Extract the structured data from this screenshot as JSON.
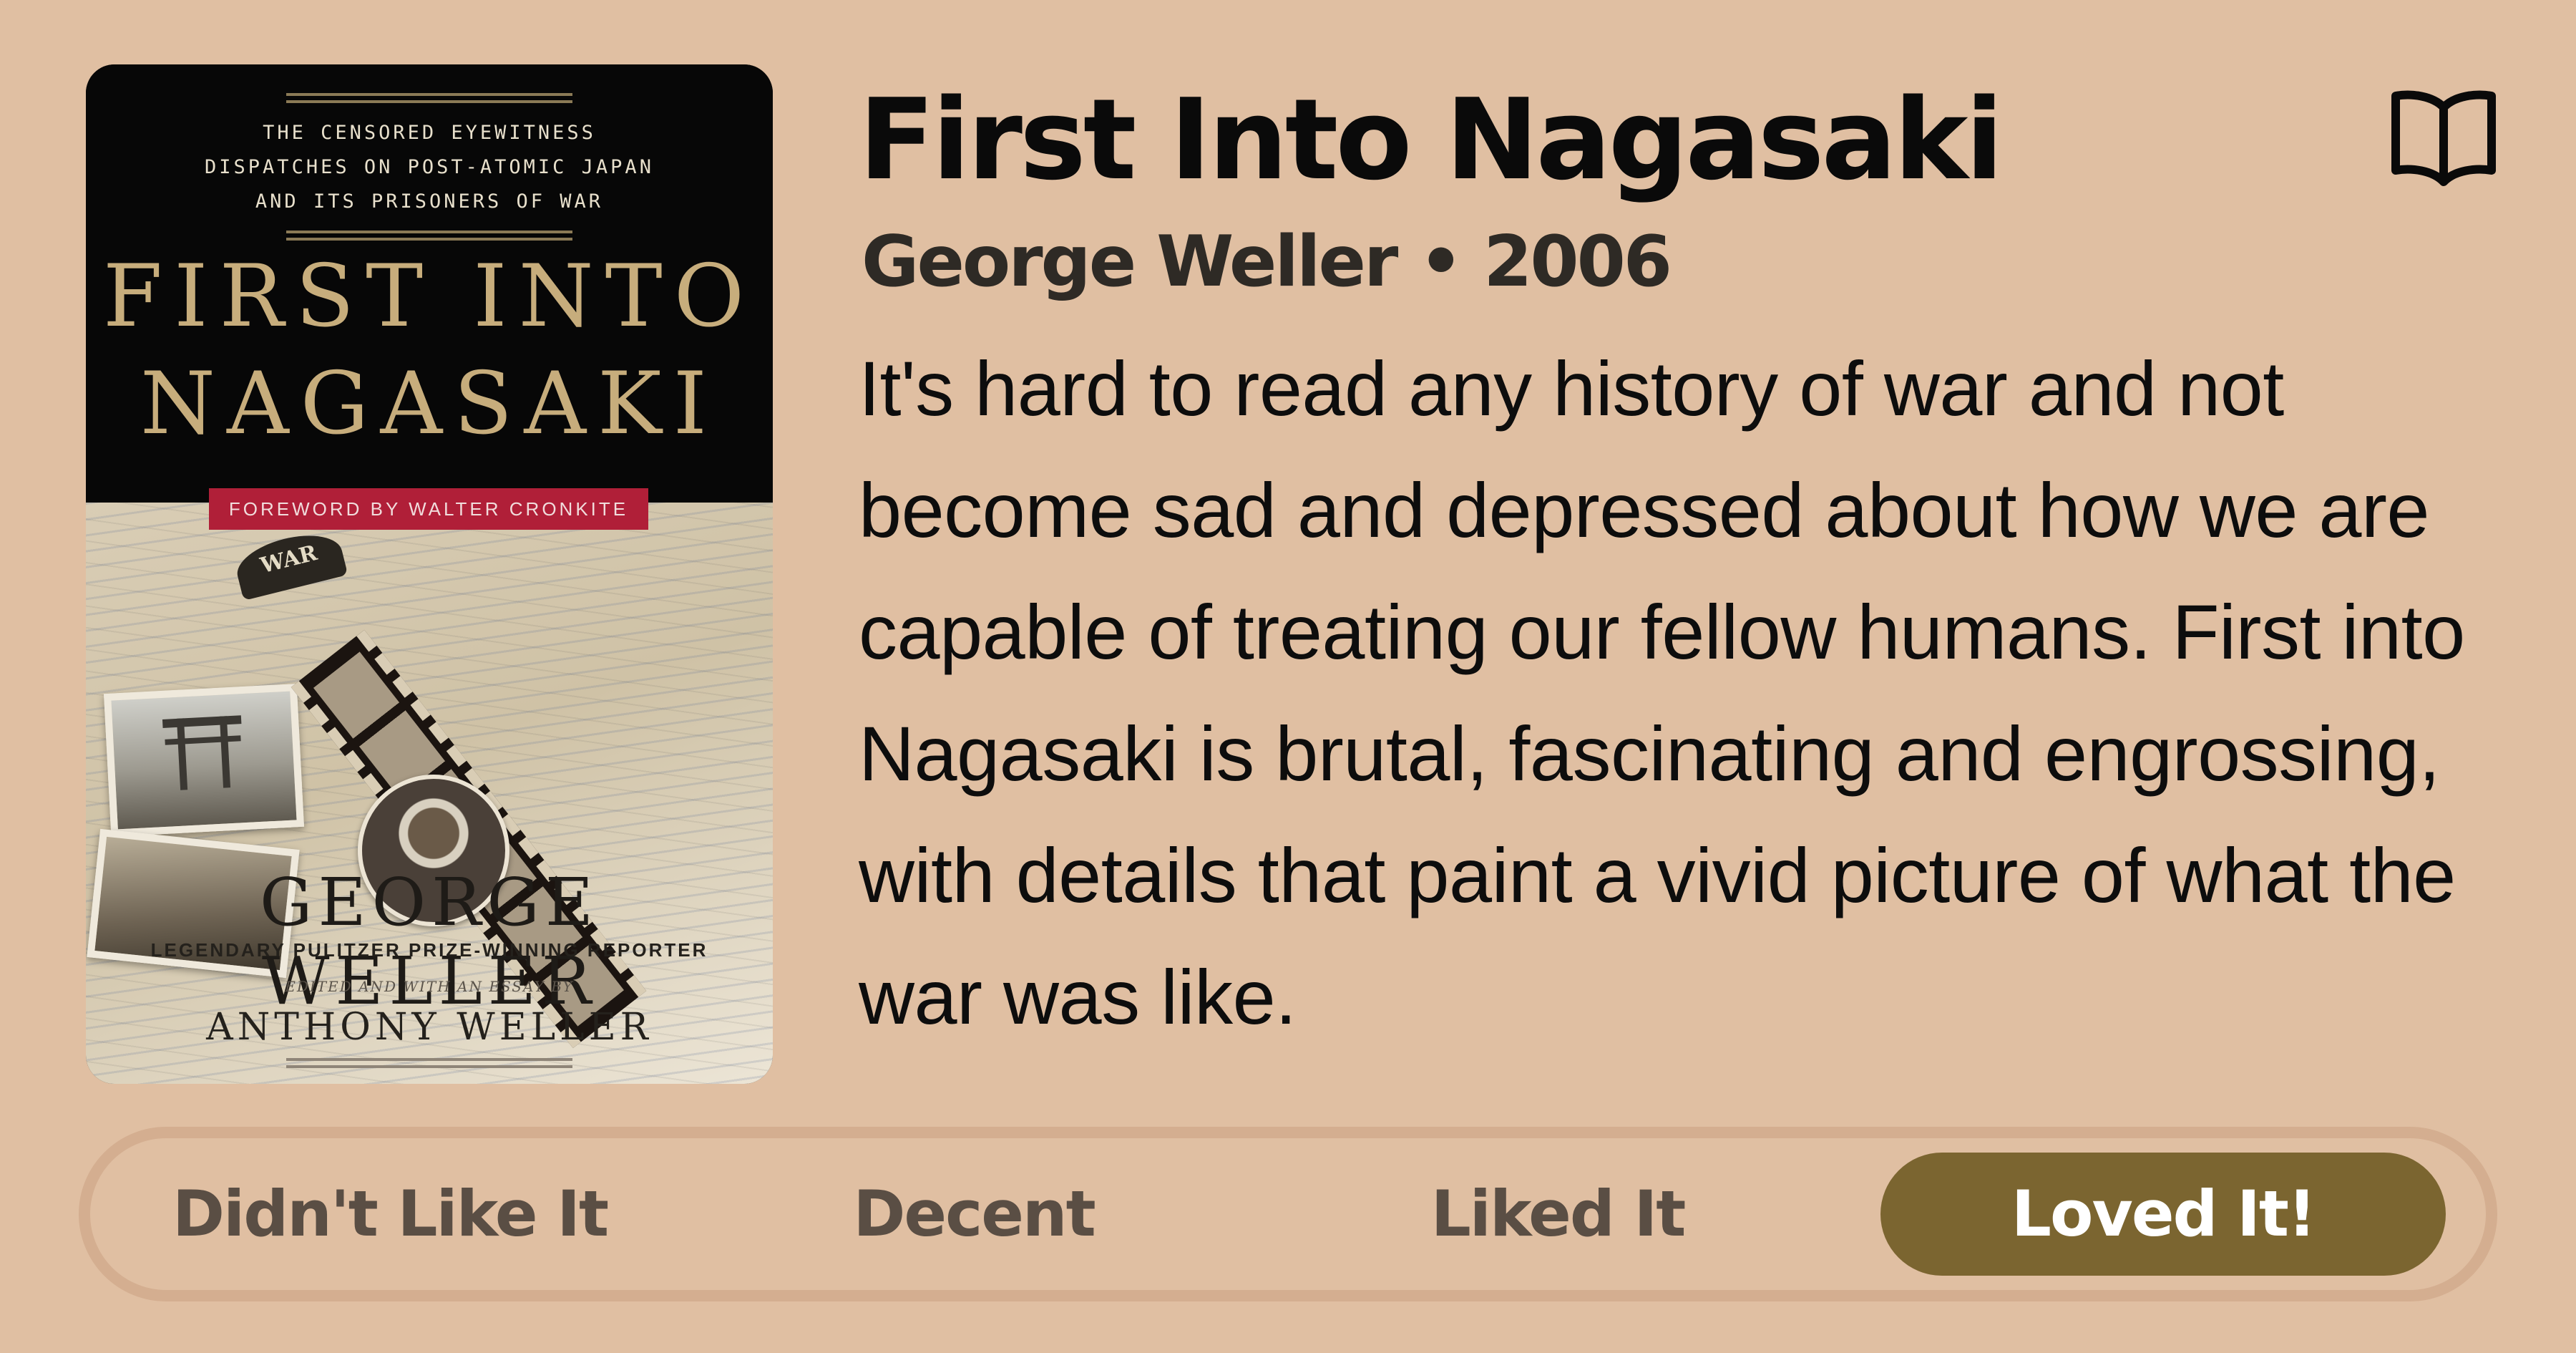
{
  "book": {
    "title": "First Into Nagasaki",
    "byline": "George Weller • 2006",
    "description": "It's hard to read any history of war and not become sad and depressed about how we are capable of treating our fellow humans. First into Nagasaki is brutal, fascinating and engrossing, with details that paint a vivid picture of what the war was like."
  },
  "cover": {
    "tagline_1": "The censored eyewitness",
    "tagline_2": "dispatches on post-atomic Japan",
    "tagline_3": "and its prisoners of war",
    "title_line_1": "First into",
    "title_line_2": "Nagasaki",
    "foreword": "Foreword by Walter Cronkite",
    "badge": "WAR",
    "author": "George Weller",
    "author_sub": "Legendary Pulitzer Prize-winning reporter",
    "editor_line": "Edited and with an Essay by",
    "editor": "Anthony Weller"
  },
  "icons": {
    "book": "open-book-icon"
  },
  "rating": {
    "options": [
      {
        "label": "Didn't Like It",
        "selected": false
      },
      {
        "label": "Decent",
        "selected": false
      },
      {
        "label": "Liked It",
        "selected": false
      },
      {
        "label": "Loved It!",
        "selected": true
      }
    ]
  },
  "colors": {
    "background": "#e0bfa2",
    "selected_pill": "#7b6530",
    "bar_border": "#d4ae90",
    "unselected_text": "#5a4e44"
  }
}
